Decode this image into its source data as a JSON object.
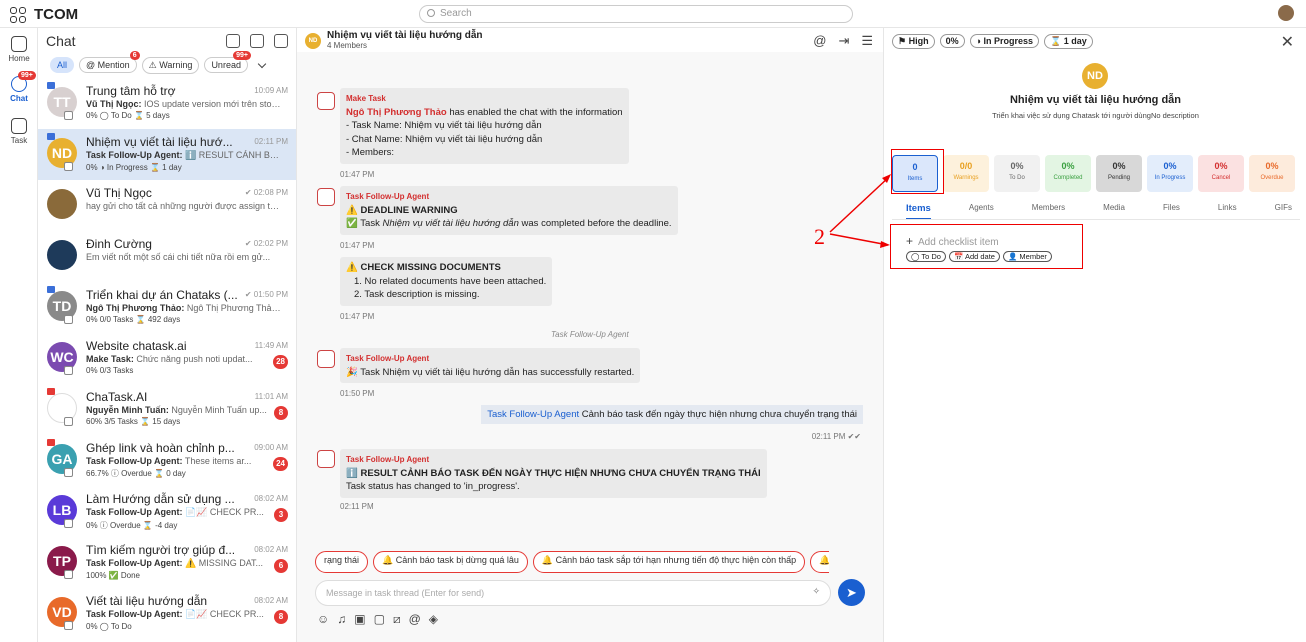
{
  "app": {
    "name": "TCOM",
    "search_placeholder": "Search"
  },
  "rail": {
    "home": "Home",
    "chat": "Chat",
    "chat_badge": "99+",
    "task": "Task"
  },
  "list": {
    "title": "Chat",
    "filters": [
      {
        "label": "All"
      },
      {
        "label": "@ Mention",
        "badge": "6"
      },
      {
        "label": "Warning"
      },
      {
        "label": "Unread",
        "badge": "99+"
      }
    ],
    "conversations": [
      {
        "initials": "TT",
        "color": "#d8d0d0",
        "name": "Trung tâm hỗ trợ",
        "time": "10:09 AM",
        "msg_sender": "Vũ Thị Ngọc:",
        "msg": " IOS update version mới trên stor...",
        "meta": "0%  ◯ To Do  ⌛ 5 days",
        "flag": "blue"
      },
      {
        "initials": "ND",
        "color": "#e8b030",
        "name": "Nhiệm vụ viết tài liệu hướ...",
        "time": "02:11 PM",
        "msg_sender": "Task Follow-Up Agent:",
        "msg": " ℹ️ RESULT CẢNH BÁ...",
        "meta": "0%  ◑ In Progress  ⌛ 1 day",
        "flag": "blue",
        "active": true
      },
      {
        "initials": "",
        "color": "#8a6a3a",
        "name": "Vũ Thị Ngọc",
        "time": "✔ 02:08 PM",
        "msg_sender": "",
        "msg": "hay gửi cho tất cả những người được assign tro...",
        "meta": ""
      },
      {
        "initials": "",
        "color": "#1e3a5a",
        "name": "Đinh Cường",
        "time": "✔ 02:02 PM",
        "msg_sender": "",
        "msg": "Em viết nốt một số cái chi tiết nữa rồi em gử...",
        "meta": ""
      },
      {
        "initials": "TD",
        "color": "#8a8a8a",
        "name": "Triển khai dự án Chataks (...",
        "time": "✔ 01:50 PM",
        "msg_sender": "Ngô Thị Phương Thảo:",
        "msg": " Ngô Thị Phương Thảo ...",
        "meta": "0%  0/0 Tasks  ⌛ 492 days",
        "flag": "blue"
      },
      {
        "initials": "WC",
        "color": "#7b4bb0",
        "name": "Website chatask.ai",
        "time": "11:49 AM",
        "msg_sender": "Make Task:",
        "msg": " Chức năng push noti updat...",
        "meta": "0%  0/3 Tasks",
        "badge": "28"
      },
      {
        "initials": "",
        "color": "#ffffff",
        "name": "ChaTask.AI",
        "time": "11:01 AM",
        "msg_sender": "Nguyễn Minh Tuấn:",
        "msg": " Nguyễn Minh Tuấn up...",
        "meta": "60%  3/5 Tasks  ⌛ 15 days",
        "flag": "red",
        "badge": "8"
      },
      {
        "initials": "GA",
        "color": "#3aa0b0",
        "name": "Ghép link và hoàn chỉnh p...",
        "time": "09:00 AM",
        "msg_sender": "Task Follow-Up Agent:",
        "msg": " These items ar...",
        "meta": "66.7%  ⓘ Overdue  ⌛ 0 day",
        "flag": "red",
        "badge": "24"
      },
      {
        "initials": "LB",
        "color": "#5a3ad8",
        "name": "Làm Hướng dẫn sử dụng ...",
        "time": "08:02 AM",
        "msg_sender": "Task Follow-Up Agent:",
        "msg": " 📄📈 CHECK PR...",
        "meta": "0%  ⓘ Overdue  ⌛ -4 day",
        "badge": "3"
      },
      {
        "initials": "TP",
        "color": "#8a1a4a",
        "name": "Tìm kiếm người trợ giúp đ...",
        "time": "08:02 AM",
        "msg_sender": "Task Follow-Up Agent:",
        "msg": " ⚠️ MISSING DAT...",
        "meta": "100%  ✅ Done",
        "badge": "6"
      },
      {
        "initials": "VD",
        "color": "#e86a2a",
        "name": "Viết tài liệu hướng dẫn",
        "time": "08:02 AM",
        "msg_sender": "Task Follow-Up Agent:",
        "msg": " 📄📈 CHECK PR...",
        "meta": "0%  ◯ To Do",
        "badge": "8"
      }
    ]
  },
  "chat": {
    "title": "Nhiệm vụ viết tài liệu hướng dẫn",
    "members": "4 Members",
    "m1": {
      "sender": "Make Task",
      "name": "Ngô Thị Phương Thảo",
      "text": " has enabled the chat with the information",
      "l1": "- Task Name: Nhiệm vụ viết tài liệu hướng dẫn",
      "l2": "- Chat Name: Nhiệm vụ viết tài liệu hướng dẫn",
      "l3": "- Members:",
      "time": "01:47 PM"
    },
    "m2": {
      "sender": "Task Follow-Up Agent",
      "title": "⚠️ DEADLINE WARNING",
      "pre": "✅ Task ",
      "task": "Nhiệm vụ viết tài liệu hướng dẫn",
      "post": " was completed before the deadline.",
      "time": "01:47 PM"
    },
    "m3": {
      "title": "⚠️ CHECK MISSING DOCUMENTS",
      "l1": "1. No related documents have been attached.",
      "l2": "2. Task description is missing.",
      "time": "01:47 PM"
    },
    "sys": "Task Follow-Up Agent",
    "m4": {
      "sender": "Task Follow-Up Agent",
      "text": "🎉 Task Nhiệm vụ viết tài liệu hướng dẫn has successfully restarted.",
      "time": "01:50 PM"
    },
    "out": {
      "name": "Task Follow-Up Agent",
      "text": " Cảnh báo task đến ngày thực hiện nhưng chưa chuyển trạng thái",
      "time": "02:11 PM ✔✔"
    },
    "m5": {
      "sender": "Task Follow-Up Agent",
      "title": "ℹ️ RESULT CẢNH BÁO TASK ĐẾN NGÀY THỰC HIỆN NHƯNG CHƯA CHUYỂN TRẠNG THÁI",
      "text": "Task status has changed to 'in_progress'.",
      "time": "02:11 PM"
    },
    "suggestions": [
      "rạng thái",
      "🔔 Cảnh báo task bị dừng quá lâu",
      "🔔 Cảnh báo task sắp tới hạn nhưng tiến độ thực hiện còn thấp",
      "🔔 Cảnh b"
    ],
    "input_placeholder": "Message in task thread (Enter for send)"
  },
  "panel": {
    "priority": "High",
    "progress": "0%",
    "status": "In Progress",
    "duration": "1 day",
    "initials": "ND",
    "title": "Nhiệm vụ viết tài liệu hướng dẫn",
    "desc": "Triển khai việc sử dụng Chatask tới người dùngNo description",
    "stats": [
      {
        "v": "0",
        "l": "Items",
        "bg": "#dbe7fb",
        "c": "#1a5fd0"
      },
      {
        "v": "0/0",
        "l": "Warnings",
        "bg": "#fdf1dc",
        "c": "#e8a020"
      },
      {
        "v": "0%",
        "l": "To Do",
        "bg": "#f1f1f1",
        "c": "#666"
      },
      {
        "v": "0%",
        "l": "Completed",
        "bg": "#e3f5e3",
        "c": "#3aa040"
      },
      {
        "v": "0%",
        "l": "Pending",
        "bg": "#d8d8d8",
        "c": "#333"
      },
      {
        "v": "0%",
        "l": "In Progress",
        "bg": "#e3edfb",
        "c": "#1a5fd0"
      },
      {
        "v": "0%",
        "l": "Cancel",
        "bg": "#fbe1e1",
        "c": "#d32f2f"
      },
      {
        "v": "0%",
        "l": "Overdue",
        "bg": "#fdebdc",
        "c": "#e86a2a"
      }
    ],
    "tabs": [
      "Items",
      "Agents",
      "Members",
      "Media",
      "Files",
      "Links",
      "GIFs"
    ],
    "add_item": "Add checklist item",
    "chips": [
      "◯ To Do",
      "📅 Add date",
      "👤 Member"
    ]
  },
  "annotation": {
    "label": "2"
  }
}
